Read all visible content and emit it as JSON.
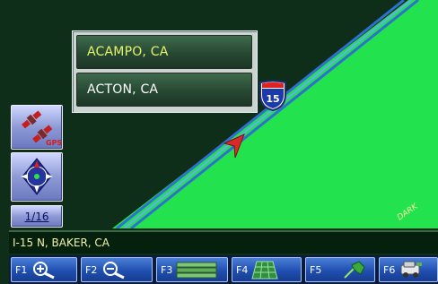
{
  "map": {
    "road_label": "DARK",
    "interstate_number": "15",
    "colors": {
      "land": "#1ee44c",
      "dark_land": "#0f2e1a",
      "road": "#3d78c8"
    }
  },
  "suggestions": [
    {
      "label": "ACAMPO, CA",
      "state": "highlighted"
    },
    {
      "label": "ACTON, CA",
      "state": "normal"
    }
  ],
  "side_buttons": {
    "zoom_scale": "1/16"
  },
  "status_bar": {
    "text": "I-15 N, BAKER, CA"
  },
  "function_keys": [
    {
      "key": "F1",
      "icon": "zoom-in-icon"
    },
    {
      "key": "F2",
      "icon": "zoom-out-icon"
    },
    {
      "key": "F3",
      "icon": "route-list-icon"
    },
    {
      "key": "F4",
      "icon": "grid-view-icon"
    },
    {
      "key": "F5",
      "icon": "pushpin-icon"
    },
    {
      "key": "F6",
      "icon": "vehicle-icon"
    }
  ]
}
